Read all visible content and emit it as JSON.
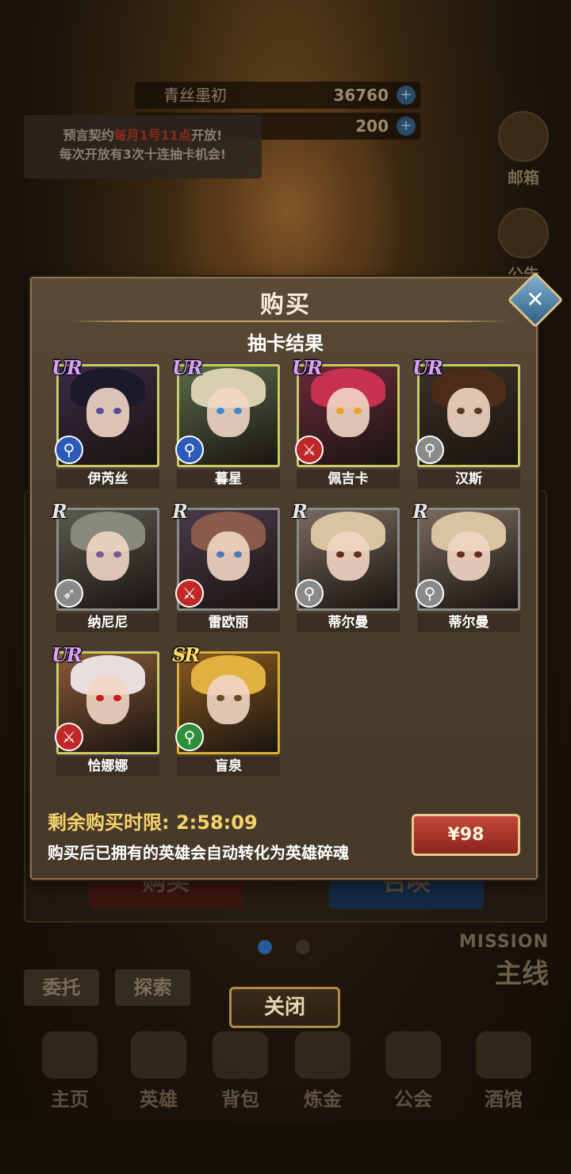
{
  "background": {
    "currencies": [
      {
        "label": "青丝墨初",
        "value": "36760"
      },
      {
        "label": "",
        "value": "200"
      }
    ],
    "notice": {
      "line1_prefix": "预言契约",
      "line1_highlight": "每月1号11点",
      "line1_suffix": "开放!",
      "line2": "每次开放有3次十连抽卡机会!"
    },
    "side_buttons": [
      "邮箱",
      "公告"
    ],
    "buy_label": "购买",
    "summon_label": "召唤",
    "small_buttons": [
      "委托",
      "探索"
    ],
    "mission_en": "MISSION",
    "mission_cn": "主线",
    "nav": [
      "主页",
      "英雄",
      "背包",
      "炼金",
      "公会",
      "酒馆"
    ]
  },
  "close_button": "关闭",
  "modal": {
    "title": "购买",
    "close_icon": "✕",
    "subtitle": "抽卡结果",
    "cards": [
      {
        "name": "伊芮丝",
        "rarity": "UR",
        "class": "blue",
        "class_icon": "staff",
        "hair": "#1c1a2a",
        "bg": "#3a2a45",
        "eye": "#5a4aa0"
      },
      {
        "name": "暮星",
        "rarity": "UR",
        "class": "blue",
        "class_icon": "staff",
        "hair": "#d8cfb0",
        "bg": "#5a6a4a",
        "eye": "#3a8ad0"
      },
      {
        "name": "佩吉卡",
        "rarity": "UR",
        "class": "red",
        "class_icon": "sword",
        "hair": "#c83050",
        "bg": "#6a2a3a",
        "eye": "#e8a020"
      },
      {
        "name": "汉斯",
        "rarity": "UR",
        "class": "grey",
        "class_icon": "staff",
        "hair": "#4a2c18",
        "bg": "#3a3028",
        "eye": "#5a3a20"
      },
      {
        "name": "纳尼尼",
        "rarity": "R",
        "class": "grey",
        "class_icon": "bow",
        "hair": "#8a8a7a",
        "bg": "#5a5a50",
        "eye": "#7a5a9a"
      },
      {
        "name": "雷欧丽",
        "rarity": "R",
        "class": "red",
        "class_icon": "sword",
        "hair": "#8a5a4a",
        "bg": "#4a3a4a",
        "eye": "#4a7ab0"
      },
      {
        "name": "蒂尔曼",
        "rarity": "R",
        "class": "grey",
        "class_icon": "staff",
        "hair": "#d8c4a0",
        "bg": "#7a6a60",
        "eye": "#6a2a1a"
      },
      {
        "name": "蒂尔曼",
        "rarity": "R",
        "class": "grey",
        "class_icon": "staff",
        "hair": "#d8c4a0",
        "bg": "#7a6a60",
        "eye": "#6a2a1a"
      },
      {
        "name": "恰娜娜",
        "rarity": "UR",
        "class": "red",
        "class_icon": "sword",
        "hair": "#e8dede",
        "bg": "#8a5a3a",
        "eye": "#c81a1a"
      },
      {
        "name": "盲泉",
        "rarity": "SR",
        "class": "green",
        "class_icon": "staff",
        "hair": "#e0b040",
        "bg": "#8a5a20",
        "eye": "#6a4a20"
      }
    ],
    "timer_label": "剩余购买时限:",
    "timer_value": "2:58:09",
    "note": "购买后已拥有的英雄会自动转化为英雄碎魂",
    "price": "¥98"
  },
  "colors": {
    "ur_frame": "#c4d14a",
    "sr_frame": "#d8b13a",
    "r_frame": "#8a8a8a",
    "timer": "#f5d26a",
    "price_button": "#b03a2e"
  }
}
